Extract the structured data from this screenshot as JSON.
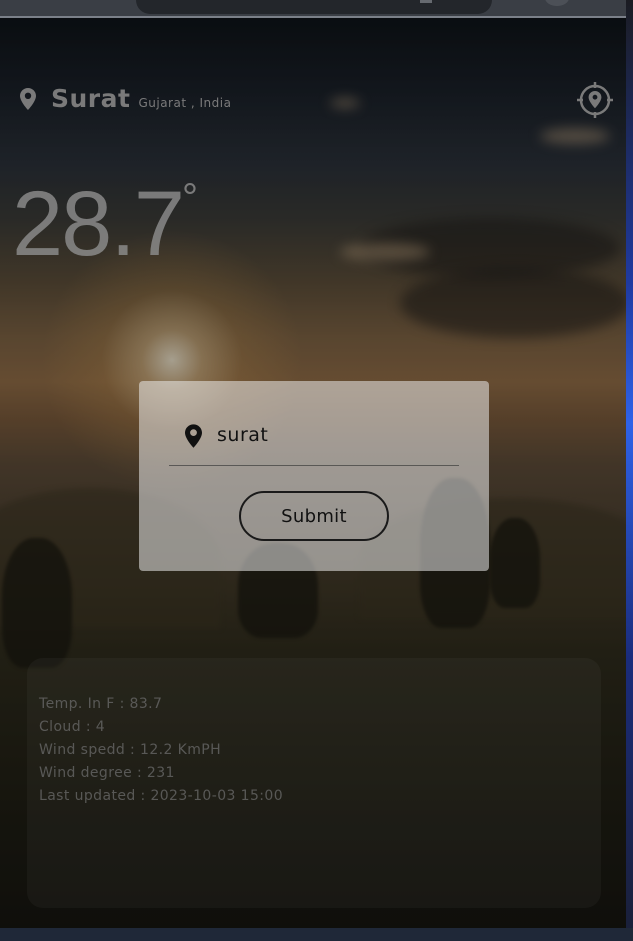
{
  "location": {
    "city": "Surat",
    "region": "Gujarat , India",
    "pin_icon": "location-pin-icon",
    "locate_icon": "locate-me-icon"
  },
  "weather": {
    "temperature": "28.7",
    "degree_symbol": "°",
    "details": [
      "Temp. In F : 83.7",
      "Cloud : 4",
      "Wind spedd : 12.2 KmPH",
      "Wind degree : 231",
      "Last updated : 2023-10-03 15:00"
    ]
  },
  "search_modal": {
    "input_value": "surat",
    "submit_label": "Submit"
  },
  "colors": {
    "accent_text": "#a9a9a9",
    "button_border": "#1a1a1a"
  }
}
